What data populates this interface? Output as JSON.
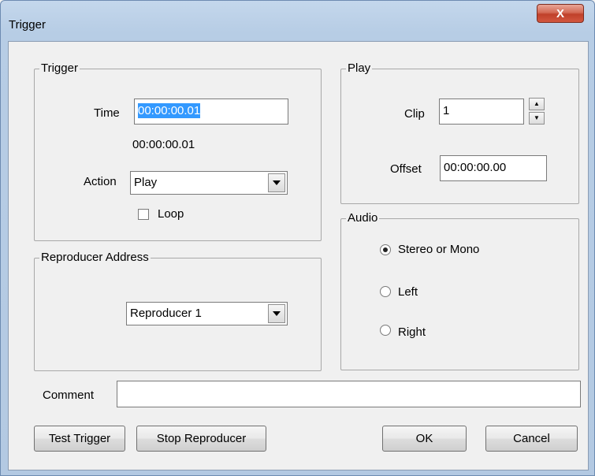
{
  "window": {
    "title": "Trigger",
    "close_glyph": "X"
  },
  "trigger_group": {
    "label": "Trigger",
    "time_label": "Time",
    "time_value": "00:00:00.01",
    "time_display": "00:00:00.01",
    "action_label": "Action",
    "action_value": "Play",
    "loop_label": "Loop",
    "loop_checked": false
  },
  "reproducer_group": {
    "label": "Reproducer Address",
    "value": "Reproducer 1"
  },
  "play_group": {
    "label": "Play",
    "clip_label": "Clip",
    "clip_value": "1",
    "offset_label": "Offset",
    "offset_value": "00:00:00.00"
  },
  "audio_group": {
    "label": "Audio",
    "options": [
      {
        "label": "Stereo or Mono",
        "selected": true
      },
      {
        "label": "Left",
        "selected": false
      },
      {
        "label": "Right",
        "selected": false
      }
    ]
  },
  "comment": {
    "label": "Comment",
    "value": ""
  },
  "buttons": {
    "test_trigger": "Test Trigger",
    "stop_reproducer": "Stop Reproducer",
    "ok": "OK",
    "cancel": "Cancel"
  }
}
